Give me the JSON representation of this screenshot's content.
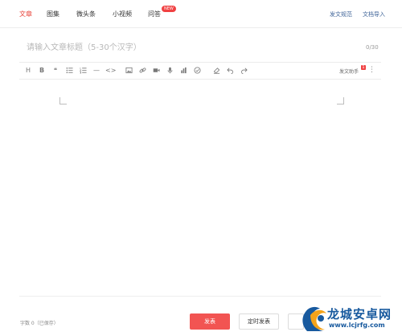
{
  "nav": {
    "tabs": [
      {
        "label": "文章",
        "active": true
      },
      {
        "label": "图集",
        "active": false
      },
      {
        "label": "微头条",
        "active": false
      },
      {
        "label": "小视频",
        "active": false
      },
      {
        "label": "问答",
        "active": false
      }
    ],
    "new_badge": "NEW",
    "links": {
      "spec": "发文规范",
      "import": "文档导入"
    }
  },
  "editor": {
    "title_placeholder": "请输入文章标题（5-30个汉字）",
    "title_value": "",
    "char_counter": "0/30",
    "toolbar": {
      "icons": [
        "heading-icon",
        "bold-icon",
        "quote-icon",
        "unordered-list-icon",
        "ordered-list-icon",
        "divider-icon",
        "code-icon",
        "image-icon",
        "link-icon",
        "video-icon",
        "audio-icon",
        "chart-icon",
        "vote-icon",
        "eraser-icon",
        "undo-icon",
        "redo-icon"
      ],
      "heading_glyph": "H",
      "bold_glyph": "B",
      "quote_glyph": "❝",
      "divider_glyph": "—",
      "code_glyph": "<>",
      "helper_label": "发文助手",
      "helper_badge": "1",
      "more_glyph": "⋮"
    }
  },
  "footer": {
    "status": "字数 0（已保存）",
    "publish_label": "发表",
    "timed_label": "定时发表"
  },
  "watermark": {
    "brand": "龙城安卓网",
    "url": "www.lcjrfg.com",
    "colors": {
      "primary": "#17599e",
      "accent": "#f4a31a"
    }
  },
  "colors": {
    "accent": "#e8443b",
    "link": "#406599",
    "publish_button": "#f25452"
  }
}
